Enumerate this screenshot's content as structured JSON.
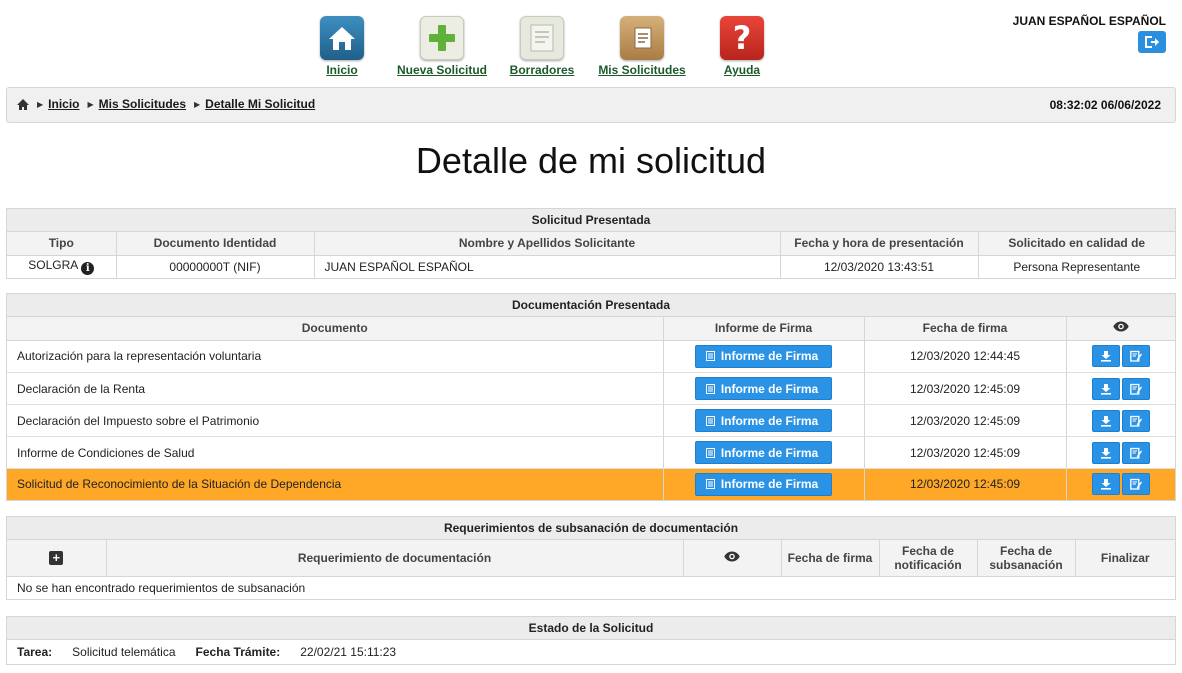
{
  "nav": {
    "items": [
      {
        "label": "Inicio",
        "icon": "home-icon",
        "color": "#2f7fb0"
      },
      {
        "label": "Nueva Solicitud",
        "icon": "new-request-icon",
        "color": "#e9ecdf"
      },
      {
        "label": "Borradores",
        "icon": "drafts-icon",
        "color": "#e4e7dc"
      },
      {
        "label": "Mis Solicitudes",
        "icon": "folder-icon",
        "color": "#c49a5e"
      },
      {
        "label": "Ayuda",
        "icon": "help-icon",
        "color": "#d9342b"
      }
    ]
  },
  "user": {
    "name": "JUAN ESPAÑOL ESPAÑOL",
    "logout_icon": "logout-icon"
  },
  "breadcrumb": {
    "home_icon": "home-icon",
    "items": [
      "Inicio",
      "Mis Solicitudes",
      "Detalle Mi Solicitud"
    ],
    "datetime": "08:32:02 06/06/2022"
  },
  "page_title": "Detalle de mi solicitud",
  "solicitud": {
    "title": "Solicitud Presentada",
    "headers": [
      "Tipo",
      "Documento Identidad",
      "Nombre y Apellidos Solicitante",
      "Fecha y hora de presentación",
      "Solicitado en calidad de"
    ],
    "row": {
      "tipo": "SOLGRA",
      "documento": "00000000T (NIF)",
      "nombre": "JUAN ESPAÑOL ESPAÑOL",
      "fecha": "12/03/2020 13:43:51",
      "calidad": "Persona Representante"
    }
  },
  "documentacion": {
    "title": "Documentación Presentada",
    "headers": [
      "Documento",
      "Informe de Firma",
      "Fecha de firma"
    ],
    "view_icon": "eye-icon",
    "button_label": "Informe de Firma",
    "highlight_color": "#ffa726",
    "rows": [
      {
        "documento": "Autorización para la representación voluntaria",
        "fecha": "12/03/2020 12:44:45"
      },
      {
        "documento": "Declaración de la Renta",
        "fecha": "12/03/2020 12:45:09"
      },
      {
        "documento": "Declaración del Impuesto sobre el Patrimonio",
        "fecha": "12/03/2020 12:45:09"
      },
      {
        "documento": "Informe de Condiciones de Salud",
        "fecha": "12/03/2020 12:45:09"
      },
      {
        "documento": "Solicitud de Reconocimiento de la Situación de Dependencia",
        "fecha": "12/03/2020 12:45:09"
      }
    ]
  },
  "requerimientos": {
    "title": "Requerimientos de subsanación de documentación",
    "headers": [
      "Requerimiento de documentación",
      "Fecha de firma",
      "Fecha de notificación",
      "Fecha de subsanación",
      "Finalizar"
    ],
    "empty": "No se han encontrado requerimientos de subsanación"
  },
  "estado": {
    "title": "Estado de la Solicitud",
    "tarea_label": "Tarea:",
    "tarea_value": "Solicitud telemática",
    "fecha_label": "Fecha Trámite:",
    "fecha_value": "22/02/21 15:11:23"
  },
  "colors": {
    "primary": "#2b93e6",
    "nav_label": "#1c5a2a"
  }
}
